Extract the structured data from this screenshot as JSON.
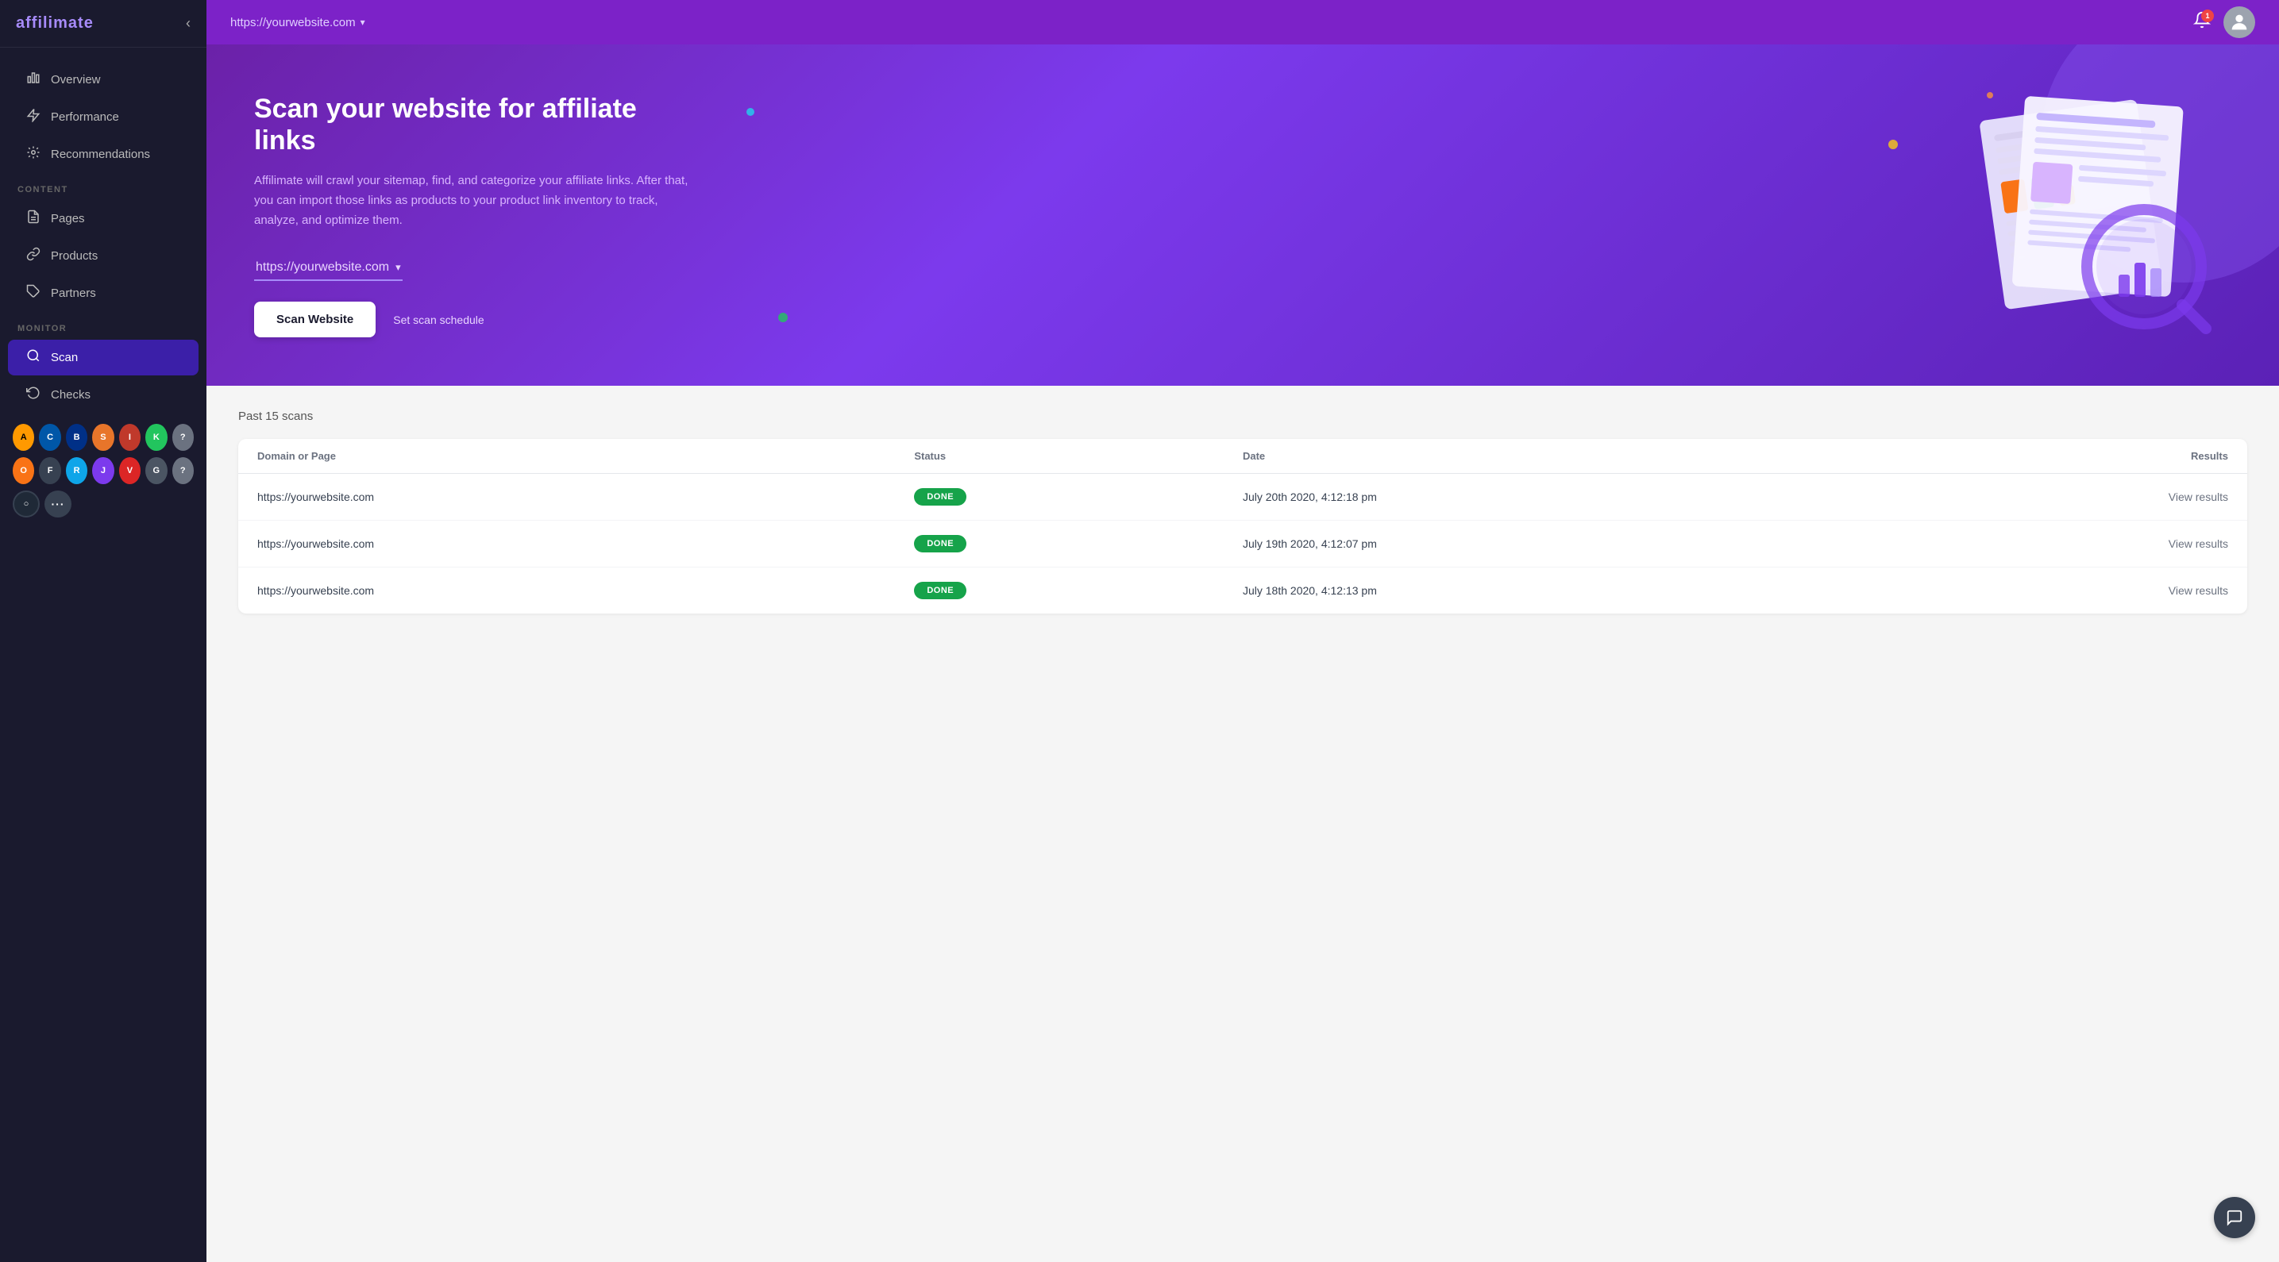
{
  "sidebar": {
    "logo": "affilimate",
    "collapse_btn": "‹",
    "nav_items": [
      {
        "id": "overview",
        "label": "Overview",
        "icon": "📊",
        "active": false
      },
      {
        "id": "performance",
        "label": "Performance",
        "icon": "⚡",
        "active": false
      },
      {
        "id": "recommendations",
        "label": "Recommendations",
        "icon": "✦",
        "active": false
      }
    ],
    "content_section": "CONTENT",
    "content_items": [
      {
        "id": "pages",
        "label": "Pages",
        "icon": "📄",
        "active": false
      },
      {
        "id": "products",
        "label": "Products",
        "icon": "🔗",
        "active": false
      },
      {
        "id": "partners",
        "label": "Partners",
        "icon": "🏷️",
        "active": false
      }
    ],
    "monitor_section": "MONITOR",
    "monitor_items": [
      {
        "id": "scan",
        "label": "Scan",
        "icon": "🔍",
        "active": true
      },
      {
        "id": "checks",
        "label": "Checks",
        "icon": "🔄",
        "active": false
      }
    ],
    "partner_rows": [
      [
        {
          "label": "A",
          "class": "amazon"
        },
        {
          "label": "C",
          "class": "cj"
        },
        {
          "label": "B",
          "class": "bb"
        },
        {
          "label": "S",
          "class": "shareasale"
        },
        {
          "label": "I",
          "class": "impact"
        },
        {
          "label": "K",
          "class": "skimlinks"
        },
        {
          "label": "?",
          "class": "unknown"
        }
      ],
      [
        {
          "label": "O",
          "class": "orange2"
        },
        {
          "label": "F",
          "class": "gray2"
        },
        {
          "label": "R",
          "class": "rupee"
        },
        {
          "label": "J",
          "class": "jrp"
        },
        {
          "label": "V",
          "class": "red2"
        },
        {
          "label": "G",
          "class": "gray3"
        },
        {
          "label": "?",
          "class": "gray4"
        }
      ],
      [
        {
          "label": "○",
          "class": "circle-dark"
        },
        {
          "label": "···",
          "class": "dots"
        }
      ]
    ]
  },
  "topbar": {
    "url": "https://yourwebsite.com",
    "chevron": "▾",
    "notif_count": "1"
  },
  "hero": {
    "title": "Scan your website for affiliate links",
    "description": "Affilimate will crawl your sitemap, find, and categorize your affiliate links. After that, you can import those links as products to your product link inventory to track, analyze, and optimize them.",
    "url_select": "https://yourwebsite.com",
    "scan_btn": "Scan Website",
    "schedule_btn": "Set scan schedule"
  },
  "scans": {
    "section_title": "Past 15 scans",
    "columns": [
      "Domain or Page",
      "Status",
      "Date",
      "Results"
    ],
    "rows": [
      {
        "domain": "https://yourwebsite.com",
        "status": "DONE",
        "date": "July 20th 2020, 4:12:18 pm",
        "results": "View results"
      },
      {
        "domain": "https://yourwebsite.com",
        "status": "DONE",
        "date": "July 19th 2020, 4:12:07 pm",
        "results": "View results"
      },
      {
        "domain": "https://yourwebsite.com",
        "status": "DONE",
        "date": "July 18th 2020, 4:12:13 pm",
        "results": "View results"
      }
    ]
  },
  "chat": {
    "icon": "💬"
  }
}
